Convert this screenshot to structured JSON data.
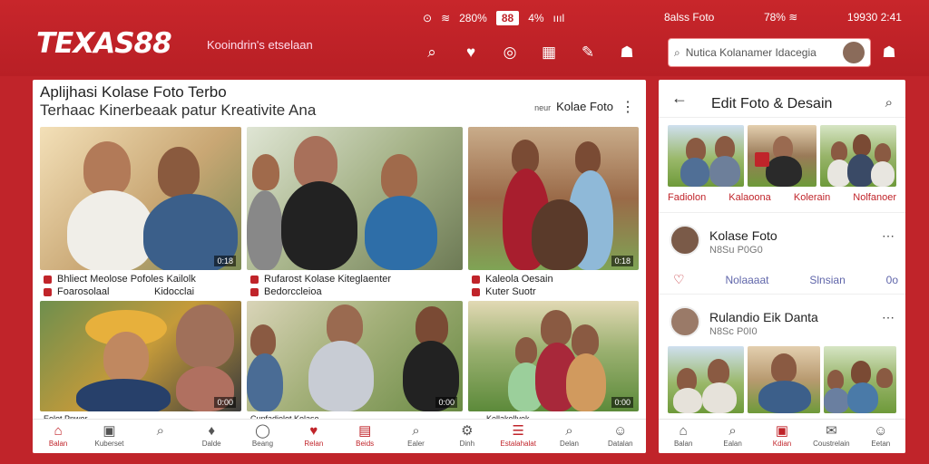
{
  "header": {
    "brand": "TEXAS88",
    "tagline": "Kooindrin's etselaan",
    "status_left": [
      "⊙",
      "≋",
      "280%"
    ],
    "status_chip": "88",
    "status_mid": [
      "4%",
      "ıııl"
    ],
    "status_right": [
      "8alss Foto",
      "78% ≋",
      "19930 2:41"
    ],
    "icons": [
      "search-icon",
      "pin-icon",
      "camera-icon",
      "grid-icon",
      "video-icon",
      "profile-icon"
    ],
    "search_placeholder": "Nutica Kolanamer Idacegia"
  },
  "left": {
    "title": "Aplijhasi Kolase Foto Terbo",
    "subtitle": "Terhaac Kinerbeaak patur Kreativite Ana",
    "right_pre": "neur",
    "right_label": "Kolae Foto",
    "more": "⋮",
    "tiles": [
      {
        "dur": "0:18",
        "cap1": "Bhliect Meolose Pofoles Kailolk",
        "cap2": "Foarosolaal",
        "cap2b": "Kidocclai"
      },
      {
        "dur": "",
        "cap1": "Rufarost Kolase Kiteglaenter",
        "cap2": "Bedorccleioa",
        "cap2b": ""
      },
      {
        "dur": "0:18",
        "cap1": "Kaleola Oesain",
        "cap2": "Kuter Suotr",
        "cap2b": ""
      },
      {
        "dur": "0:00",
        "cap1": "Eolot Pnwer",
        "cap2": "",
        "cap2b": ""
      },
      {
        "dur": "0:00",
        "cap1": "Cunfadiolot Kolase",
        "cap2": "",
        "cap2b": ""
      },
      {
        "dur": "0:00",
        "cap1": "Kellakollyek",
        "cap2": "",
        "cap2b": ""
      }
    ],
    "nav": [
      {
        "icon": "⌂",
        "label": "Balan",
        "on": true
      },
      {
        "icon": "▣",
        "label": "Kuberset",
        "on": false
      },
      {
        "icon": "⌕",
        "label": "",
        "on": false
      },
      {
        "icon": "♦",
        "label": "Dalde",
        "on": false
      },
      {
        "icon": "◯",
        "label": "Beang",
        "on": false
      },
      {
        "icon": "♥",
        "label": "Relan",
        "on": true
      },
      {
        "icon": "▤",
        "label": "Beids",
        "on": true
      },
      {
        "icon": "⌕",
        "label": "Ealer",
        "on": false
      },
      {
        "icon": "⚙",
        "label": "Dinh",
        "on": false
      },
      {
        "icon": "☰",
        "label": "Estalahalat",
        "on": true
      },
      {
        "icon": "⌕",
        "label": "Delan",
        "on": false
      },
      {
        "icon": "☺",
        "label": "Datalan",
        "on": false
      }
    ]
  },
  "right": {
    "title": "Edit Foto & Desain",
    "tags": [
      "Fadiolon",
      "Kalaoona",
      "Kolerain",
      "Nolfanoer"
    ],
    "post1": {
      "name": "Kolase Foto",
      "sub": "N8Su P0G0"
    },
    "actions": [
      "Nolaaaat",
      "Slnsian",
      "0o"
    ],
    "post2": {
      "name": "Rulandio Eik Danta",
      "sub": "N8Sc P0I0"
    },
    "nav": [
      {
        "icon": "⌂",
        "label": "Balan",
        "on": false
      },
      {
        "icon": "⌕",
        "label": "Ealan",
        "on": false
      },
      {
        "icon": "▣",
        "label": "Kdian",
        "on": true
      },
      {
        "icon": "✉",
        "label": "Coustrelain",
        "on": false
      },
      {
        "icon": "☺",
        "label": "Eetan",
        "on": false
      }
    ]
  }
}
